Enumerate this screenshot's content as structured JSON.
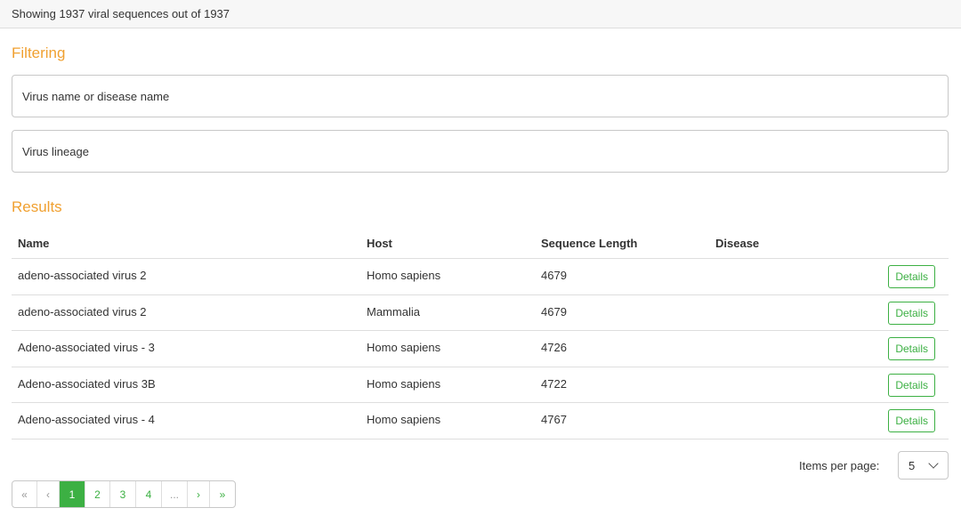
{
  "header": {
    "summary": "Showing 1937 viral sequences out of 1937"
  },
  "filtering": {
    "title": "Filtering",
    "name_placeholder": "Virus name or disease name",
    "name_value": "",
    "lineage_placeholder": "Virus lineage",
    "lineage_value": ""
  },
  "results": {
    "title": "Results",
    "columns": [
      "Name",
      "Host",
      "Sequence Length",
      "Disease"
    ],
    "details_label": "Details",
    "rows": [
      {
        "name": "adeno-associated virus 2",
        "host": "Homo sapiens",
        "length": "4679",
        "disease": ""
      },
      {
        "name": "adeno-associated virus 2",
        "host": "Mammalia",
        "length": "4679",
        "disease": ""
      },
      {
        "name": "Adeno-associated virus - 3",
        "host": "Homo sapiens",
        "length": "4726",
        "disease": ""
      },
      {
        "name": "Adeno-associated virus 3B",
        "host": "Homo sapiens",
        "length": "4722",
        "disease": ""
      },
      {
        "name": "Adeno-associated virus - 4",
        "host": "Homo sapiens",
        "length": "4767",
        "disease": ""
      }
    ]
  },
  "pagination": {
    "items_per_page_label": "Items per page:",
    "items_per_page_value": "5",
    "first": "«",
    "prev": "‹",
    "pages": [
      "1",
      "2",
      "3",
      "4"
    ],
    "current_page": "1",
    "ellipsis": "...",
    "next": "›",
    "last": "»"
  },
  "colors": {
    "accent": "#3cb043",
    "section_title": "#f0a030"
  },
  "icons": {
    "select_chevron": "chevron-down-icon"
  }
}
